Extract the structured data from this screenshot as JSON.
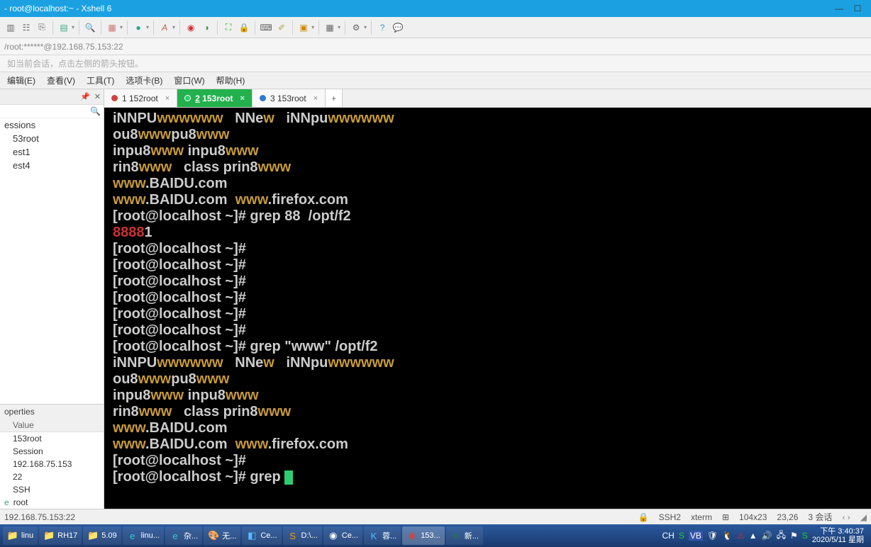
{
  "title": "- root@localhost:~ - Xshell 6",
  "address": "/root:******@192.168.75.153:22",
  "hint": "如当前会话，点击左侧的箭头按钮。",
  "menu": [
    "编辑(E)",
    "查看(V)",
    "工具(T)",
    "选项卡(B)",
    "窗口(W)",
    "帮助(H)"
  ],
  "sessions": {
    "header": "essions",
    "items": [
      "53root",
      "est1",
      "est4"
    ]
  },
  "properties": {
    "header": "operties",
    "sub": "Value",
    "rows": [
      "153root",
      "Session",
      "192.168.75.153",
      "22",
      "SSH"
    ],
    "last_icon": "e",
    "last_label": "root"
  },
  "tabs": [
    {
      "label": "1 152root",
      "dot": "red"
    },
    {
      "label": "2 153root",
      "dot": "green",
      "active": true
    },
    {
      "label": "3 153root",
      "dot": "blue"
    }
  ],
  "terminal": [
    [
      {
        "t": "iNNPU",
        "c": "w"
      },
      {
        "t": "wwwwww",
        "c": "y"
      },
      {
        "t": "   NNe",
        "c": "w"
      },
      {
        "t": "w",
        "c": "y"
      },
      {
        "t": "   iNNpu",
        "c": "w"
      },
      {
        "t": "wwwwww",
        "c": "y"
      }
    ],
    [
      {
        "t": "ou8",
        "c": "w"
      },
      {
        "t": "www",
        "c": "y"
      },
      {
        "t": "pu8",
        "c": "w"
      },
      {
        "t": "www",
        "c": "y"
      }
    ],
    [
      {
        "t": "inpu8",
        "c": "w"
      },
      {
        "t": "www",
        "c": "y"
      },
      {
        "t": " inpu8",
        "c": "w"
      },
      {
        "t": "www",
        "c": "y"
      }
    ],
    [
      {
        "t": "rin8",
        "c": "w"
      },
      {
        "t": "www",
        "c": "y"
      },
      {
        "t": "   class prin8",
        "c": "w"
      },
      {
        "t": "www",
        "c": "y"
      }
    ],
    [
      {
        "t": "www",
        "c": "y"
      },
      {
        "t": ".BAIDU.com",
        "c": "w"
      }
    ],
    [
      {
        "t": "www",
        "c": "y"
      },
      {
        "t": ".BAIDU.com  ",
        "c": "w"
      },
      {
        "t": "www",
        "c": "y"
      },
      {
        "t": ".firefox.com",
        "c": "w"
      }
    ],
    [
      {
        "t": "[root@localhost ~]# grep 88  /opt/f2",
        "c": "w"
      }
    ],
    [
      {
        "t": "8888",
        "c": "r"
      },
      {
        "t": "1",
        "c": "w"
      }
    ],
    [
      {
        "t": "[root@localhost ~]#",
        "c": "w"
      }
    ],
    [
      {
        "t": "[root@localhost ~]#",
        "c": "w"
      }
    ],
    [
      {
        "t": "[root@localhost ~]#",
        "c": "w"
      }
    ],
    [
      {
        "t": "[root@localhost ~]#",
        "c": "w"
      }
    ],
    [
      {
        "t": "[root@localhost ~]#",
        "c": "w"
      }
    ],
    [
      {
        "t": "[root@localhost ~]#",
        "c": "w"
      }
    ],
    [
      {
        "t": "[root@localhost ~]# grep \"www\" /opt/f2",
        "c": "w"
      }
    ],
    [
      {
        "t": "iNNPU",
        "c": "w"
      },
      {
        "t": "wwwwww",
        "c": "y"
      },
      {
        "t": "   NNe",
        "c": "w"
      },
      {
        "t": "w",
        "c": "y"
      },
      {
        "t": "   iNNpu",
        "c": "w"
      },
      {
        "t": "wwwwww",
        "c": "y"
      }
    ],
    [
      {
        "t": "ou8",
        "c": "w"
      },
      {
        "t": "www",
        "c": "y"
      },
      {
        "t": "pu8",
        "c": "w"
      },
      {
        "t": "www",
        "c": "y"
      }
    ],
    [
      {
        "t": "inpu8",
        "c": "w"
      },
      {
        "t": "www",
        "c": "y"
      },
      {
        "t": " inpu8",
        "c": "w"
      },
      {
        "t": "www",
        "c": "y"
      }
    ],
    [
      {
        "t": "rin8",
        "c": "w"
      },
      {
        "t": "www",
        "c": "y"
      },
      {
        "t": "   class prin8",
        "c": "w"
      },
      {
        "t": "www",
        "c": "y"
      }
    ],
    [
      {
        "t": "www",
        "c": "y"
      },
      {
        "t": ".BAIDU.com",
        "c": "w"
      }
    ],
    [
      {
        "t": "www",
        "c": "y"
      },
      {
        "t": ".BAIDU.com  ",
        "c": "w"
      },
      {
        "t": "www",
        "c": "y"
      },
      {
        "t": ".firefox.com",
        "c": "w"
      }
    ],
    [
      {
        "t": "[root@localhost ~]#",
        "c": "w"
      }
    ],
    [
      {
        "t": "[root@localhost ~]# grep ",
        "c": "w",
        "cursor": true
      }
    ]
  ],
  "status": {
    "left": "192.168.75.153:22",
    "ssh": "SSH2",
    "term": "xterm",
    "size": "104x23",
    "pos": "23,26",
    "sess": "3 会话"
  },
  "taskbar": {
    "items": [
      {
        "label": "linu",
        "ico": "📁",
        "col": "#f0c040"
      },
      {
        "label": "RH17",
        "ico": "📁",
        "col": "#f0c040"
      },
      {
        "label": "5.09",
        "ico": "📁",
        "col": "#f0c040"
      },
      {
        "label": "linu...",
        "ico": "e",
        "col": "#3cc"
      },
      {
        "label": "杂...",
        "ico": "e",
        "col": "#3cc"
      },
      {
        "label": "无...",
        "ico": "🎨",
        "col": "#fff"
      },
      {
        "label": "Ce...",
        "ico": "◧",
        "col": "#5bf"
      },
      {
        "label": "D:\\...",
        "ico": "S",
        "col": "#f90"
      },
      {
        "label": "Ce...",
        "ico": "◉",
        "col": "#fff"
      },
      {
        "label": "蓉...",
        "ico": "K",
        "col": "#5bf"
      },
      {
        "label": "153...",
        "ico": "◉",
        "col": "#c44",
        "active": true
      },
      {
        "label": "新...",
        "ico": "X",
        "col": "#1c7e3d"
      }
    ],
    "tray_labels": {
      "ime": "CH"
    },
    "time1": "下午 3:40:37",
    "time2": "2020/5/11 星期"
  }
}
